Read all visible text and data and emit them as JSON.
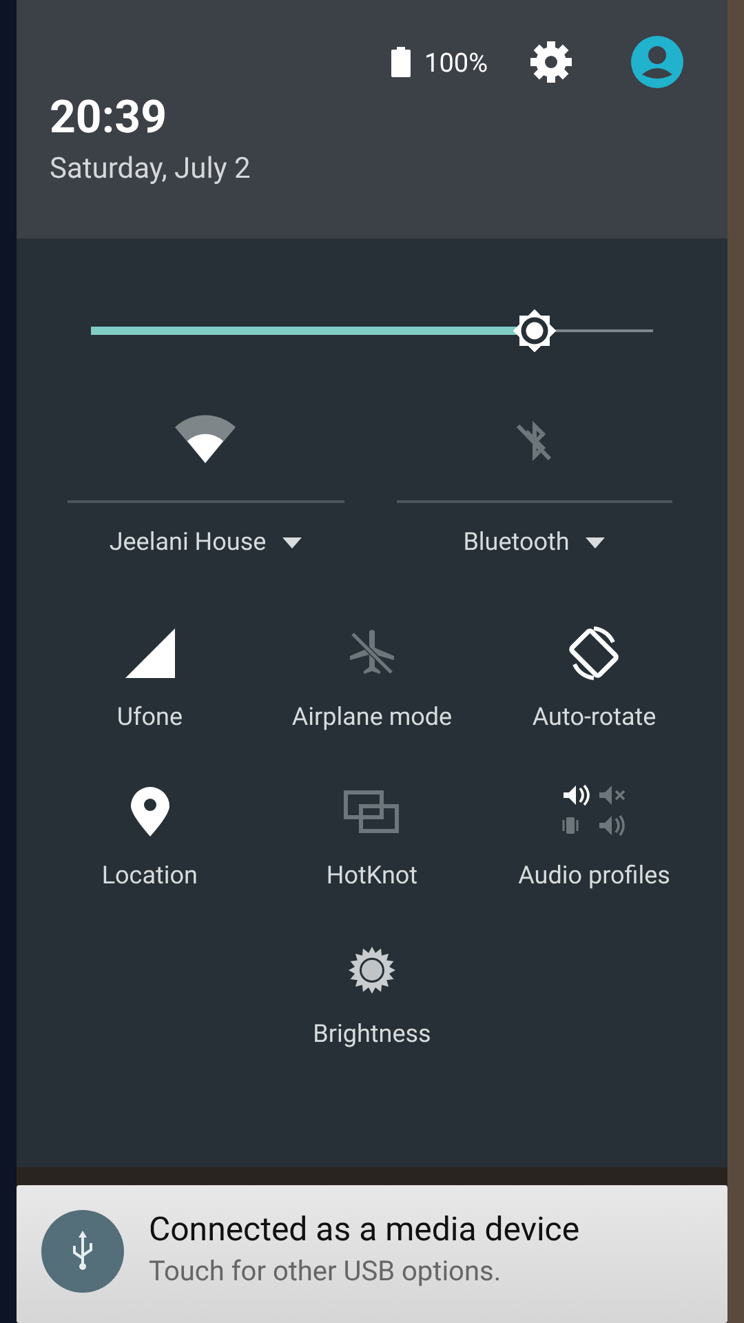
{
  "status": {
    "battery": "100%"
  },
  "clock": {
    "time": "20:39",
    "date": "Saturday, July 2"
  },
  "brightness": {
    "level": 0.79
  },
  "dual_tiles": [
    {
      "kind": "wifi",
      "label": "Jeelani House",
      "on": true
    },
    {
      "kind": "bluetooth",
      "label": "Bluetooth",
      "on": false
    }
  ],
  "tiles": [
    {
      "kind": "signal",
      "label": "Ufone",
      "on": true
    },
    {
      "kind": "airplane",
      "label": "Airplane mode",
      "on": false
    },
    {
      "kind": "rotate",
      "label": "Auto-rotate",
      "on": true
    },
    {
      "kind": "location",
      "label": "Location",
      "on": true
    },
    {
      "kind": "hotknot",
      "label": "HotKnot",
      "on": false
    },
    {
      "kind": "audio",
      "label": "Audio profiles",
      "on": true
    },
    {
      "kind": "brightness",
      "label": "Brightness",
      "on": false
    }
  ],
  "notification": {
    "title": "Connected as a media device",
    "text": "Touch for other USB options."
  }
}
